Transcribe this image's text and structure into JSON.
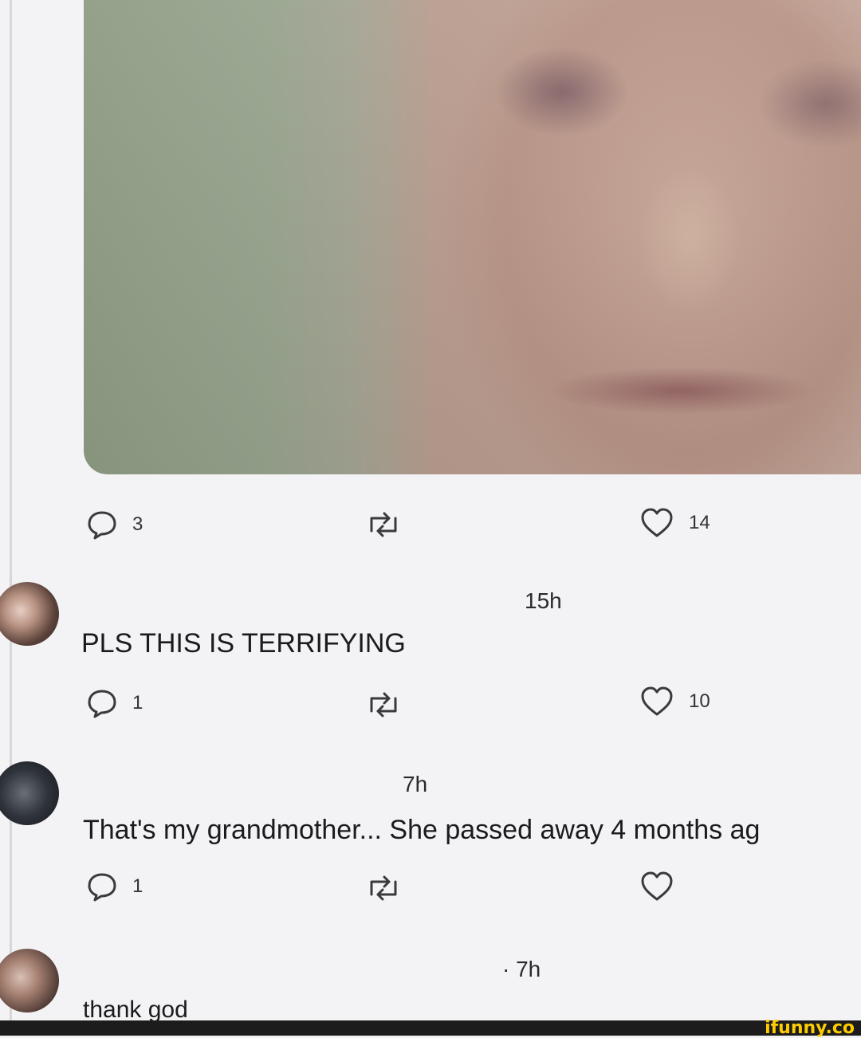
{
  "post": {
    "replies": "3",
    "likes": "14"
  },
  "comments": [
    {
      "time": "15h",
      "text": "PLS THIS IS TERRIFYING",
      "replies": "1",
      "likes": "10"
    },
    {
      "time": "7h",
      "text": "That's my grandmother... She passed away 4 months ag",
      "replies": "1",
      "likes": ""
    },
    {
      "time": "· 7h",
      "text": "thank god"
    }
  ],
  "footer": {
    "brand": "ifunny.co"
  },
  "colors": {
    "background": "#f3f3f5",
    "icon": "#333333",
    "footer": "#1c1c1c",
    "brand": "#ffcc00"
  }
}
